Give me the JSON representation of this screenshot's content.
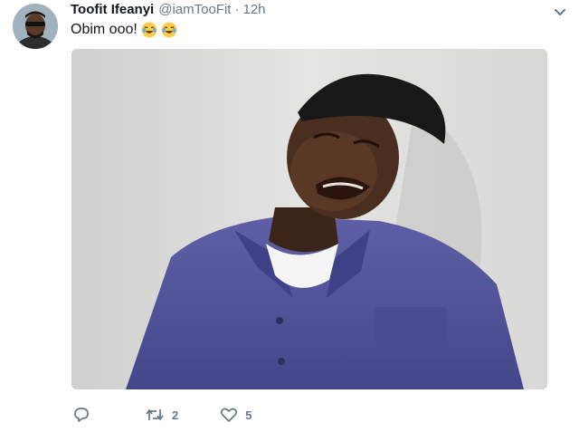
{
  "tweet": {
    "author": {
      "display_name": "Toofit Ifeanyi",
      "handle": "@iamTooFit",
      "avatar_icon": "avatar-photo"
    },
    "separator": "·",
    "timestamp": "12h",
    "text": "Obim ooo!",
    "emojis": [
      "face-with-tears-of-joy",
      "face-with-tears-of-joy"
    ],
    "media": {
      "type": "photo",
      "alt_icon": "crying-man-photo"
    },
    "actions": {
      "reply": {
        "icon": "reply-icon"
      },
      "retweet": {
        "icon": "retweet-icon",
        "count": "2"
      },
      "like": {
        "icon": "heart-icon",
        "count": "5"
      }
    },
    "menu": {
      "icon": "chevron-down-icon"
    }
  },
  "colors": {
    "text_primary": "#14171a",
    "text_secondary": "#657786",
    "background": "#ffffff"
  }
}
